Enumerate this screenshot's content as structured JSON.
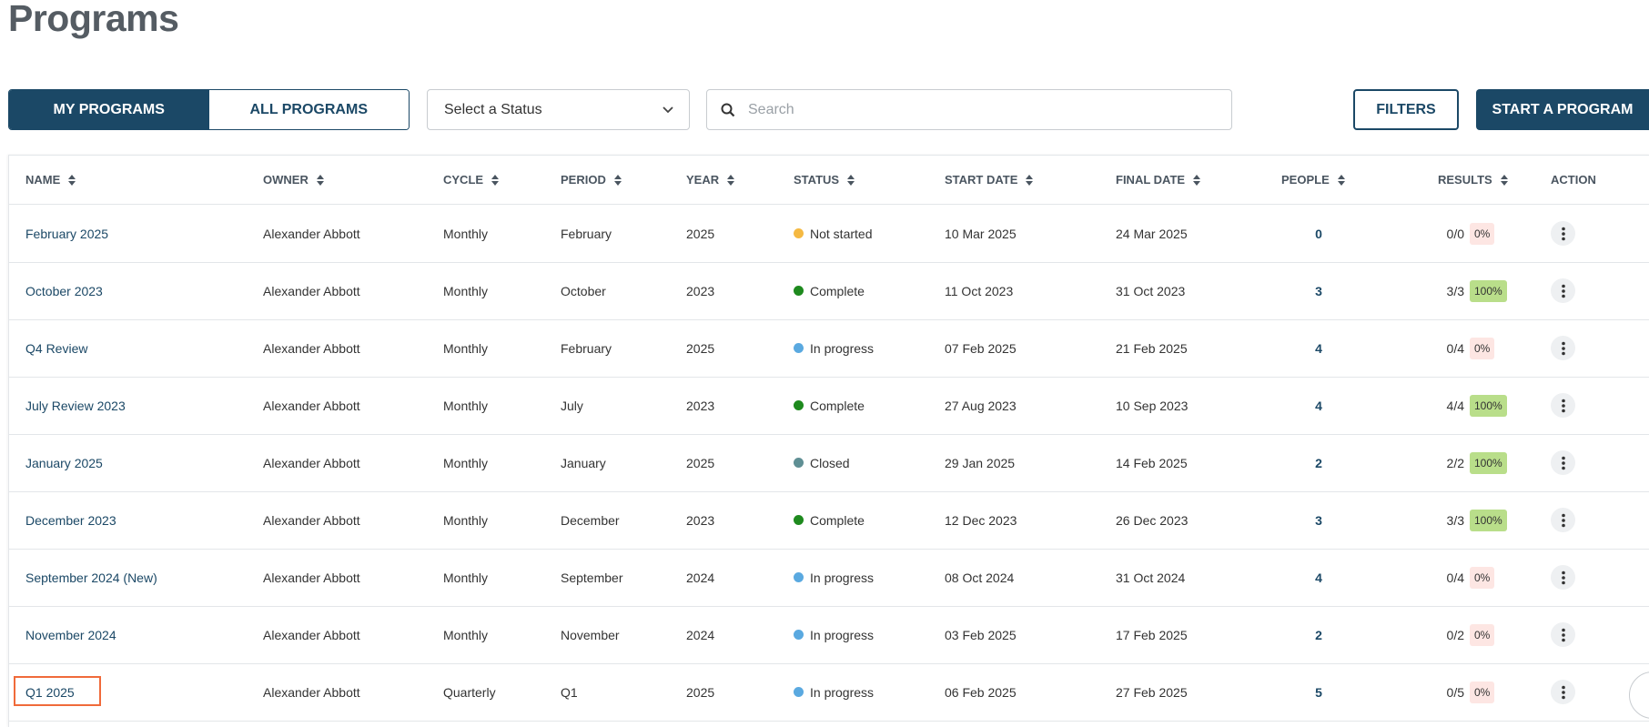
{
  "page": {
    "title": "Programs"
  },
  "toolbar": {
    "my_programs_label": "MY PROGRAMS",
    "all_programs_label": "ALL PROGRAMS",
    "status_select_value": "Select a Status",
    "search_placeholder": "Search",
    "filters_label": "FILTERS",
    "start_label": "START A PROGRAM"
  },
  "table": {
    "headers": {
      "name": "NAME",
      "owner": "OWNER",
      "cycle": "CYCLE",
      "period": "PERIOD",
      "year": "YEAR",
      "status": "STATUS",
      "start_date": "START DATE",
      "final_date": "FINAL DATE",
      "people": "PEOPLE",
      "results": "RESULTS",
      "action": "ACTION"
    },
    "rows": [
      {
        "name": "February 2025",
        "owner": "Alexander Abbott",
        "cycle": "Monthly",
        "period": "February",
        "year": "2025",
        "status": "Not started",
        "status_color": "#f5b942",
        "start": "10 Mar 2025",
        "final": "24 Mar 2025",
        "people": "0",
        "results": "0/0",
        "pct": "0%"
      },
      {
        "name": "October 2023",
        "owner": "Alexander Abbott",
        "cycle": "Monthly",
        "period": "October",
        "year": "2023",
        "status": "Complete",
        "status_color": "#1e8a1e",
        "start": "11 Oct 2023",
        "final": "31 Oct 2023",
        "people": "3",
        "results": "3/3",
        "pct": "100%"
      },
      {
        "name": "Q4 Review",
        "owner": "Alexander Abbott",
        "cycle": "Monthly",
        "period": "February",
        "year": "2025",
        "status": "In progress",
        "status_color": "#5aa9e0",
        "start": "07 Feb 2025",
        "final": "21 Feb 2025",
        "people": "4",
        "results": "0/4",
        "pct": "0%"
      },
      {
        "name": "July Review 2023",
        "owner": "Alexander Abbott",
        "cycle": "Monthly",
        "period": "July",
        "year": "2023",
        "status": "Complete",
        "status_color": "#1e8a1e",
        "start": "27 Aug 2023",
        "final": "10 Sep 2023",
        "people": "4",
        "results": "4/4",
        "pct": "100%"
      },
      {
        "name": "January 2025",
        "owner": "Alexander Abbott",
        "cycle": "Monthly",
        "period": "January",
        "year": "2025",
        "status": "Closed",
        "status_color": "#5f8f94",
        "start": "29 Jan 2025",
        "final": "14 Feb 2025",
        "people": "2",
        "results": "2/2",
        "pct": "100%"
      },
      {
        "name": "December 2023",
        "owner": "Alexander Abbott",
        "cycle": "Monthly",
        "period": "December",
        "year": "2023",
        "status": "Complete",
        "status_color": "#1e8a1e",
        "start": "12 Dec 2023",
        "final": "26 Dec 2023",
        "people": "3",
        "results": "3/3",
        "pct": "100%"
      },
      {
        "name": "September 2024 (New)",
        "owner": "Alexander Abbott",
        "cycle": "Monthly",
        "period": "September",
        "year": "2024",
        "status": "In progress",
        "status_color": "#5aa9e0",
        "start": "08 Oct 2024",
        "final": "31 Oct 2024",
        "people": "4",
        "results": "0/4",
        "pct": "0%"
      },
      {
        "name": "November 2024",
        "owner": "Alexander Abbott",
        "cycle": "Monthly",
        "period": "November",
        "year": "2024",
        "status": "In progress",
        "status_color": "#5aa9e0",
        "start": "03 Feb 2025",
        "final": "17 Feb 2025",
        "people": "2",
        "results": "0/2",
        "pct": "0%"
      },
      {
        "name": "Q1 2025",
        "owner": "Alexander Abbott",
        "cycle": "Quarterly",
        "period": "Q1",
        "year": "2025",
        "status": "In progress",
        "status_color": "#5aa9e0",
        "start": "06 Feb 2025",
        "final": "27 Feb 2025",
        "people": "5",
        "results": "0/5",
        "pct": "0%"
      }
    ]
  },
  "icons": {
    "search": "search-icon",
    "chevron": "chevron-down-icon",
    "sort": "sort-icon",
    "more": "more-vertical-icon"
  }
}
